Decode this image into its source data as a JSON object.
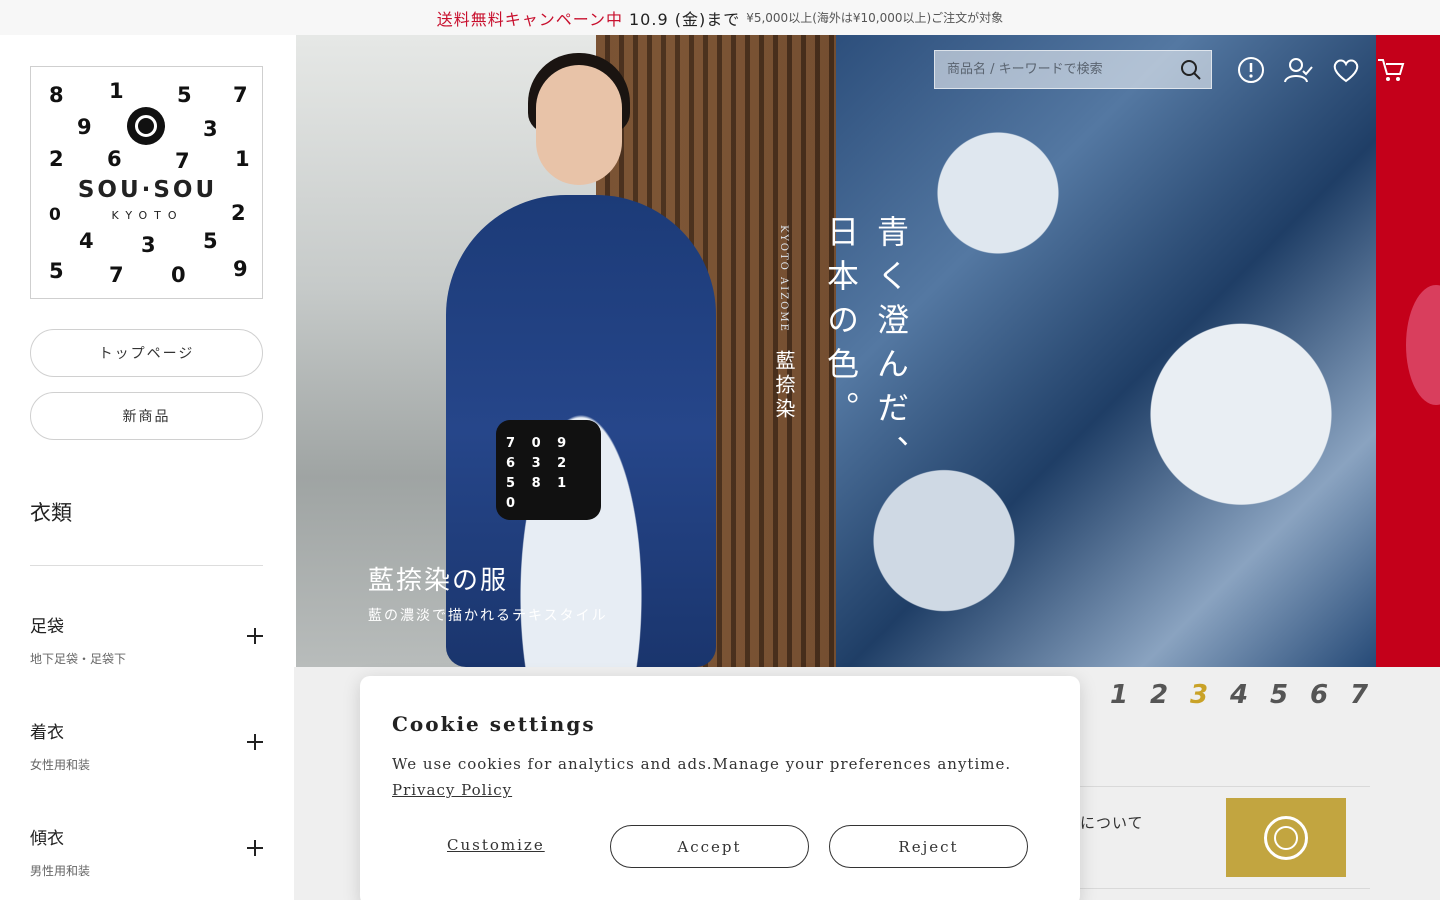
{
  "banner": {
    "campaign": "送料無料キャンペーン中",
    "date": "10.9 (金)まで",
    "condition": "¥5,000以上(海外は¥10,000以上)ご注文が対象"
  },
  "logo": {
    "digits": [
      "8",
      "1",
      "5",
      "7",
      "9",
      "3",
      "2",
      "6",
      "7",
      "1",
      "0",
      "2",
      "4",
      "3",
      "5",
      "5",
      "7",
      "0",
      "9"
    ],
    "word": "SOU·SOU",
    "city": "KYOTO"
  },
  "sidebar": {
    "buttons": [
      "トップページ",
      "新商品"
    ],
    "heading": "衣類",
    "categories": [
      {
        "title": "足袋",
        "sub": "地下足袋・足袋下"
      },
      {
        "title": "着衣",
        "sub": "女性用和装"
      },
      {
        "title": "傾衣",
        "sub": "男性用和装"
      }
    ]
  },
  "hero": {
    "vertical_main_1": "青く澄んだ、",
    "vertical_main_2": "日本の色。",
    "vertical_sub": "藍捺染",
    "vertical_en": "KYOTO AIZOME",
    "title": "藍捺染の服",
    "subtitle": "藍の濃淡で描かれるテキスタイル",
    "bag_text": "7 0 9 6 3 2 5 8 1 0"
  },
  "header": {
    "search_placeholder": "商品名 / キーワードで検索",
    "icons": [
      "search-icon",
      "info-icon",
      "account-icon",
      "heart-icon",
      "cart-icon"
    ]
  },
  "pager": {
    "pages": [
      "1",
      "2",
      "3",
      "4",
      "5",
      "6",
      "7"
    ],
    "active": 3
  },
  "about": {
    "text": "について"
  },
  "cookie": {
    "title": "Cookie settings",
    "text": "We use cookies for analytics and ads.Manage your preferences anytime.",
    "privacy": "Privacy Policy",
    "customize": "Customize",
    "accept": "Accept",
    "reject": "Reject"
  },
  "colors": {
    "accent_red": "#c8102e",
    "pager_active": "#c9a227",
    "indigo": "#1c3b78"
  }
}
